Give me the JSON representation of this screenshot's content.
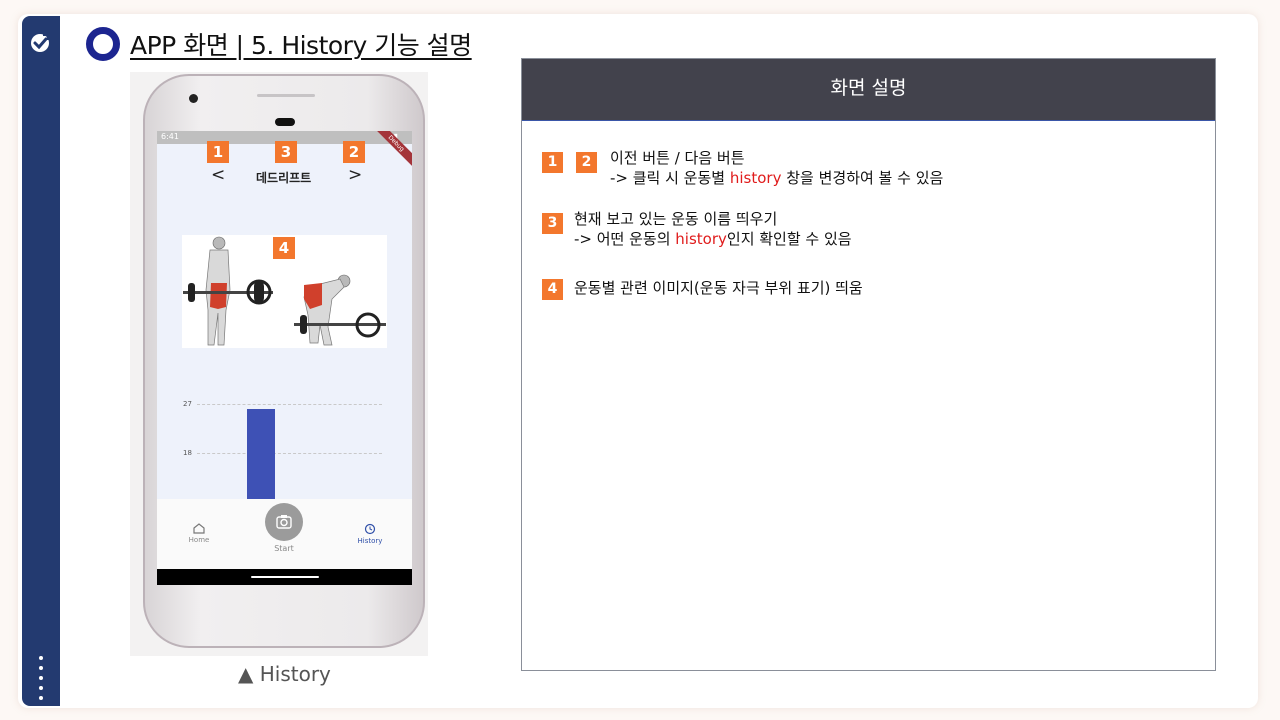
{
  "header": {
    "title": "APP 화면 | 5. History 기능 설명"
  },
  "phone": {
    "status_time": "6:41",
    "ribbon": "Debug",
    "badges": [
      "1",
      "3",
      "2",
      "4"
    ],
    "prev_symbol": "<",
    "next_symbol": ">",
    "exercise_name": "데드리프트",
    "chart": {
      "tick_labels": [
        "27",
        "18"
      ]
    },
    "bottom_nav": {
      "home": "Home",
      "start": "Start",
      "history": "History"
    },
    "caption": "▲ History"
  },
  "chart_data": {
    "type": "bar",
    "categories": [
      ""
    ],
    "values": [
      26
    ],
    "yticks": [
      18,
      27
    ],
    "ylim": [
      0,
      30
    ],
    "grid": true,
    "bar_color": "#3e51b5"
  },
  "panel": {
    "header": "화면 설명",
    "items": [
      {
        "badges": [
          "1",
          "2"
        ],
        "line1": "이전 버튼 / 다음 버튼",
        "line2_pre": "-> 클릭 시 운동별 ",
        "line2_hl": "history",
        "line2_post": " 창을 변경하여 볼 수 있음"
      },
      {
        "badges": [
          "3"
        ],
        "line1": "현재 보고 있는 운동 이름 띄우기",
        "line2_pre": "-> 어떤 운동의 ",
        "line2_hl": "history",
        "line2_post": "인지 확인할 수 있음"
      },
      {
        "badges": [
          "4"
        ],
        "line1": "운동별 관련 이미지(운동 자극 부위 표기) 띄움"
      }
    ]
  },
  "colors": {
    "sidebar": "#233a70",
    "badge": "#f3772d",
    "highlight": "#e01c1c",
    "panel_header": "#42424c",
    "bar": "#3e51b5"
  },
  "icons": [
    "checkmark-icon",
    "menu-dots-icon",
    "circle-ring-icon",
    "home-icon",
    "camera-icon",
    "history-icon"
  ]
}
